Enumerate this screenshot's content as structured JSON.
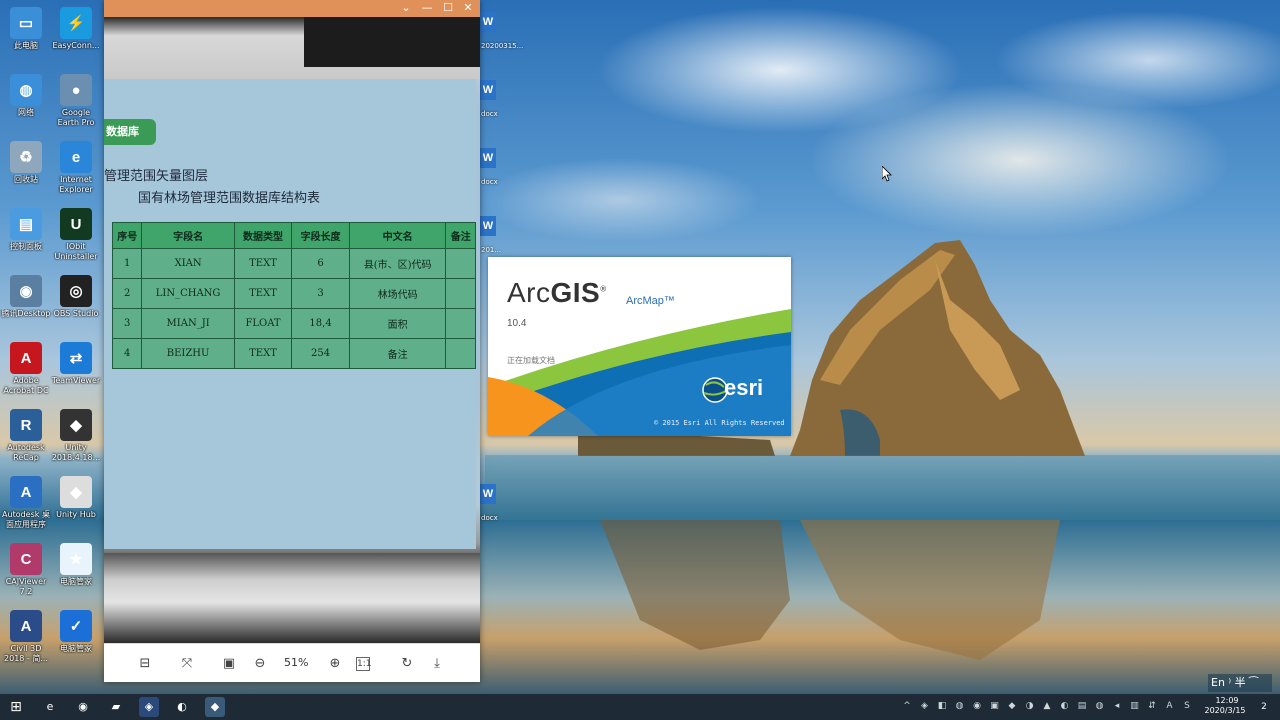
{
  "desktop_icons": [
    {
      "label": "此电脑",
      "glyph": "▭",
      "color": "#3a8fd8"
    },
    {
      "label": "EasyConn...",
      "glyph": "⚡",
      "color": "#1a9be0"
    },
    {
      "label": "网络",
      "glyph": "◍",
      "color": "#3a8fd8"
    },
    {
      "label": "Google Earth Pro",
      "glyph": "●",
      "color": "#6a8fb0"
    },
    {
      "label": "回收站",
      "glyph": "♻",
      "color": "#8fa7bd"
    },
    {
      "label": "Internet Explorer",
      "glyph": "e",
      "color": "#2a86d8"
    },
    {
      "label": "控制面板",
      "glyph": "▤",
      "color": "#4a9be0"
    },
    {
      "label": "IObit Uninstaller",
      "glyph": "U",
      "color": "#123a20"
    },
    {
      "label": "腾讯Desktop",
      "glyph": "◉",
      "color": "#5a7fa0"
    },
    {
      "label": "OBS Studio",
      "glyph": "◎",
      "color": "#222222"
    },
    {
      "label": "Adobe Acrobat DC",
      "glyph": "A",
      "color": "#c7171e"
    },
    {
      "label": "TeamViewer",
      "glyph": "⇄",
      "color": "#1d7bd8"
    },
    {
      "label": "Autodesk ReCap",
      "glyph": "R",
      "color": "#2a5f9a"
    },
    {
      "label": "Unity 2018.4.18...",
      "glyph": "◆",
      "color": "#333333"
    },
    {
      "label": "Autodesk 桌面应用程序",
      "glyph": "A",
      "color": "#2b6fc2"
    },
    {
      "label": "Unity Hub",
      "glyph": "◆",
      "color": "#dddddd"
    },
    {
      "label": "CAJViewer 7.2",
      "glyph": "C",
      "color": "#b03a6a"
    },
    {
      "label": "电脑管家",
      "glyph": "★",
      "color": "#e8f3fb"
    },
    {
      "label": "Civil 3D 2018 - 简...",
      "glyph": "A",
      "color": "#2a4d8a"
    },
    {
      "label": "电脑管家",
      "glyph": "✓",
      "color": "#1c6fd6"
    }
  ],
  "desktop_files": [
    {
      "label": "20200315..."
    },
    {
      "label": "docx"
    },
    {
      "label": "docx"
    },
    {
      "label": "201..."
    },
    {
      "label": "docx"
    }
  ],
  "viewer": {
    "db_badge": "数据库",
    "heading_1": "管理范围矢量图层",
    "heading_2": "国有林场管理范围数据库结构表",
    "columns": [
      "序号",
      "字段名",
      "数据类型",
      "字段长度",
      "中文名",
      "备注"
    ],
    "rows": [
      [
        "1",
        "XIAN",
        "TEXT",
        "6",
        "县(市、区)代码",
        ""
      ],
      [
        "2",
        "LIN_CHANG",
        "TEXT",
        "3",
        "林场代码",
        ""
      ],
      [
        "3",
        "MIAN_JI",
        "FLOAT",
        "18,4",
        "面积",
        ""
      ],
      [
        "4",
        "BEIZHU",
        "TEXT",
        "254",
        "备注",
        ""
      ]
    ],
    "zoom": "51%",
    "toolbar": {
      "fit_icon": "⊟",
      "fullscreen_icon": "⤧",
      "actual_size_icon": "▣",
      "zoom_out_icon": "⊖",
      "zoom_in_icon": "⊕",
      "one_to_one_icon": "1:1",
      "rotate_icon": "↻",
      "download_icon": "⤓"
    },
    "titlebar": {
      "chevron": "⌄",
      "min": "—",
      "max": "☐",
      "close": "✕"
    }
  },
  "splash": {
    "arc": "Arc",
    "gis": "GIS",
    "reg": "®",
    "product": "ArcMap™",
    "version": "10.4",
    "status": "正在加载文档",
    "esri": "esri",
    "copyright": "© 2015 Esri  All Rights Reserved"
  },
  "taskbar": {
    "start_icon": "⊞",
    "apps": [
      "e",
      "◉",
      "▰",
      "◈",
      "◐",
      "◆"
    ],
    "tray": [
      "^",
      "◈",
      "◧",
      "◍",
      "◉",
      "▣",
      "◆",
      "◑",
      "▲",
      "◐",
      "▤",
      "◍",
      "◂",
      "▥",
      "⇵",
      "A",
      "S"
    ],
    "time": "12:09",
    "date": "2020/3/15",
    "notification": "2"
  },
  "ime": "En ⁾ 半 ⁀"
}
